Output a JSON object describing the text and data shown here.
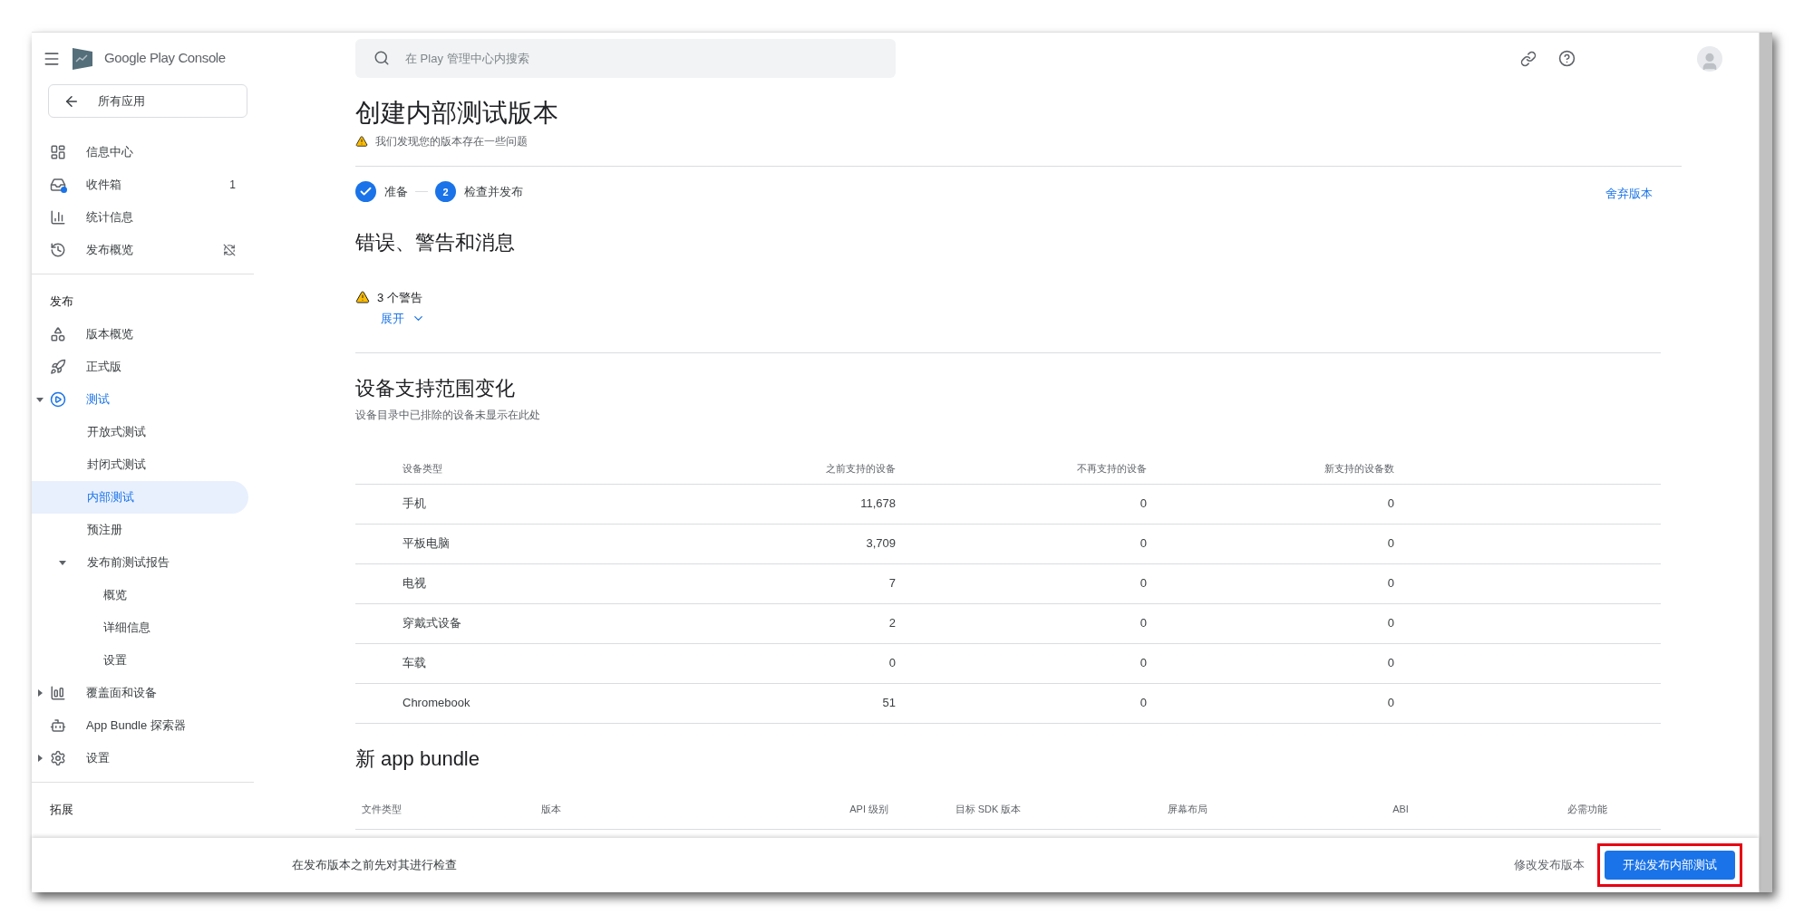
{
  "app": {
    "product_name": "Google Play Console"
  },
  "sidebar": {
    "back_button": "所有应用",
    "groups": [
      {
        "items": [
          {
            "label": "信息中心",
            "active": false
          },
          {
            "label": "收件箱",
            "active": false,
            "badge": "1"
          },
          {
            "label": "统计信息",
            "active": false
          },
          {
            "label": "发布概览",
            "active": false
          }
        ]
      },
      {
        "heading": "发布",
        "items": [
          {
            "label": "版本概览",
            "active": false
          },
          {
            "label": "正式版",
            "active": false
          },
          {
            "label": "测试",
            "active": true,
            "expanded": true,
            "children": [
              {
                "label": "开放式测试",
                "selected": false
              },
              {
                "label": "封闭式测试",
                "selected": false
              },
              {
                "label": "内部测试",
                "selected": true
              },
              {
                "label": "预注册",
                "selected": false
              },
              {
                "label": "发布前测试报告",
                "selected": false,
                "expanded": true,
                "children": [
                  {
                    "label": "概览",
                    "selected": false
                  },
                  {
                    "label": "详细信息",
                    "selected": false
                  },
                  {
                    "label": "设置",
                    "selected": false
                  }
                ]
              }
            ]
          },
          {
            "label": "覆盖面和设备",
            "active": false,
            "expanded": false
          },
          {
            "label": "App Bundle 探索器",
            "active": false
          },
          {
            "label": "设置",
            "active": false,
            "expanded": false
          }
        ]
      },
      {
        "heading": "拓展"
      }
    ]
  },
  "search": {
    "placeholder": "在 Play 管理中心内搜索"
  },
  "page": {
    "title": "创建内部测试版本",
    "warning": "我们发现您的版本存在一些问题",
    "steps": [
      {
        "label": "准备",
        "done": true
      },
      {
        "number": "2",
        "label": "检查并发布",
        "done": false
      }
    ],
    "discard_link": "舍弃版本"
  },
  "messages": {
    "title": "错误、警告和消息",
    "warning_count": "3 个警告",
    "expand_link": "展开"
  },
  "devices": {
    "title": "设备支持范围变化",
    "subtitle": "设备目录中已排除的设备未显示在此处",
    "columns": [
      "设备类型",
      "之前支持的设备",
      "不再支持的设备",
      "新支持的设备数"
    ],
    "rows": [
      [
        "手机",
        "11,678",
        "0",
        "0"
      ],
      [
        "平板电脑",
        "3,709",
        "0",
        "0"
      ],
      [
        "电视",
        "7",
        "0",
        "0"
      ],
      [
        "穿戴式设备",
        "2",
        "0",
        "0"
      ],
      [
        "车载",
        "0",
        "0",
        "0"
      ],
      [
        "Chromebook",
        "51",
        "0",
        "0"
      ]
    ]
  },
  "bundle": {
    "title": "新 app bundle",
    "columns": [
      "文件类型",
      "版本",
      "API 级别",
      "目标 SDK 版本",
      "屏幕布局",
      "ABI",
      "必需功能"
    ]
  },
  "bottom_bar": {
    "message": "在发布版本之前先对其进行检查",
    "secondary_button": "修改发布版本",
    "primary_button": "开始发布内部测试",
    "primary_highlighted": true
  }
}
